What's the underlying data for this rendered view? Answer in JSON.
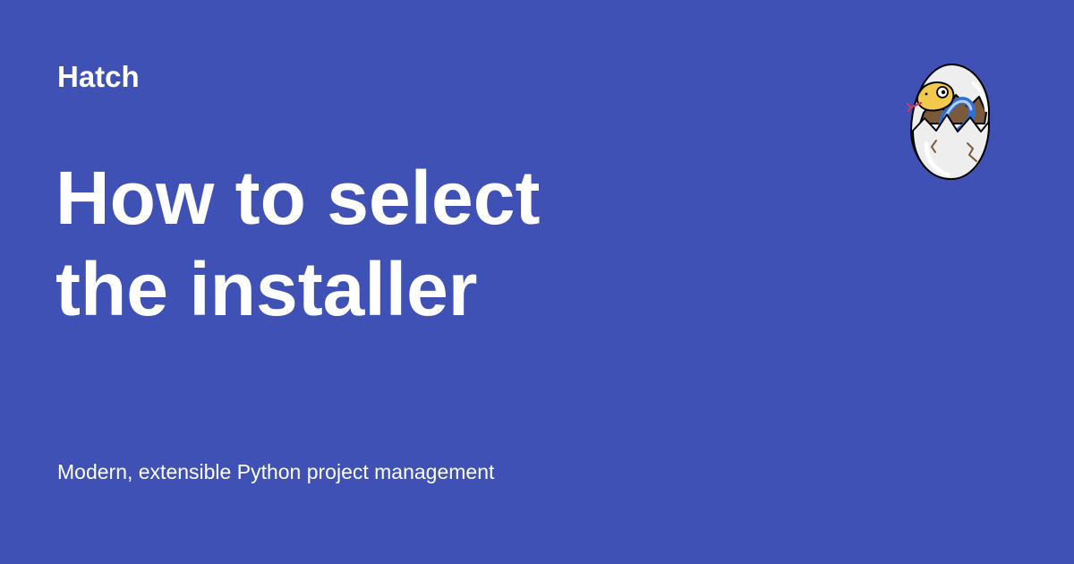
{
  "site": {
    "name": "Hatch",
    "description": "Modern, extensible Python project management"
  },
  "page": {
    "title_line_1": "How to select",
    "title_line_2": "the installer"
  },
  "logo": {
    "icon": "hatching-snake-egg-icon"
  },
  "colors": {
    "background": "#3f51b5",
    "text": "#ffffff",
    "egg_shell": "#eeeeee",
    "snake_yellow": "#f2c94c",
    "snake_blue": "#2d6fd3",
    "shell_inner": "#7a5a3a"
  }
}
